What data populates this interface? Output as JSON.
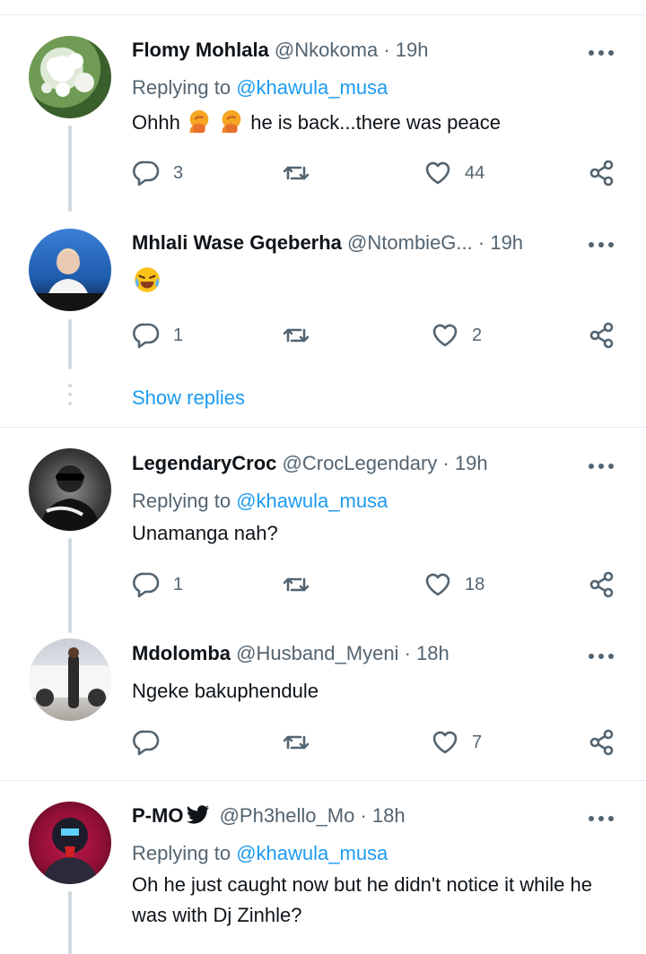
{
  "tweets": [
    {
      "name": "Flomy Mohlala",
      "handle": "@Nkokoma",
      "time": "19h",
      "replying_label": "Replying to",
      "replying_handle": "@khawula_musa",
      "text_before": "Ohhh",
      "text_after": "he is back...there was peace",
      "replies": "3",
      "retweets": "",
      "likes": "44"
    },
    {
      "name": "Mhlali Wase Gqeberha",
      "handle": "@NtombieG...",
      "time": "19h",
      "replies": "1",
      "retweets": "",
      "likes": "2"
    },
    {
      "name": "LegendaryCroc",
      "handle": "@CrocLegendary",
      "time": "19h",
      "replying_label": "Replying to",
      "replying_handle": "@khawula_musa",
      "text": "Unamanga nah?",
      "replies": "1",
      "retweets": "",
      "likes": "18"
    },
    {
      "name": "Mdolomba",
      "handle": "@Husband_Myeni",
      "time": "18h",
      "text": "Ngeke bakuphendule",
      "replies": "",
      "retweets": "",
      "likes": "7"
    },
    {
      "name": "P-MO",
      "handle": "@Ph3hello_Mo",
      "time": "18h",
      "replying_label": "Replying to",
      "replying_handle": "@khawula_musa",
      "text": "Oh he just caught now but he didn't notice it while he was with Dj Zinhle?"
    }
  ],
  "show_replies": "Show replies",
  "separator": "·",
  "colors": {
    "accent": "#1d9bf0",
    "muted": "#536471",
    "border": "#e6ecf0",
    "thread": "#cfd9de"
  },
  "icons": [
    "reply-icon",
    "retweet-icon",
    "like-icon",
    "share-icon",
    "more-icon",
    "verified-icon",
    "facepalm-emoji",
    "tears-of-joy-emoji"
  ]
}
